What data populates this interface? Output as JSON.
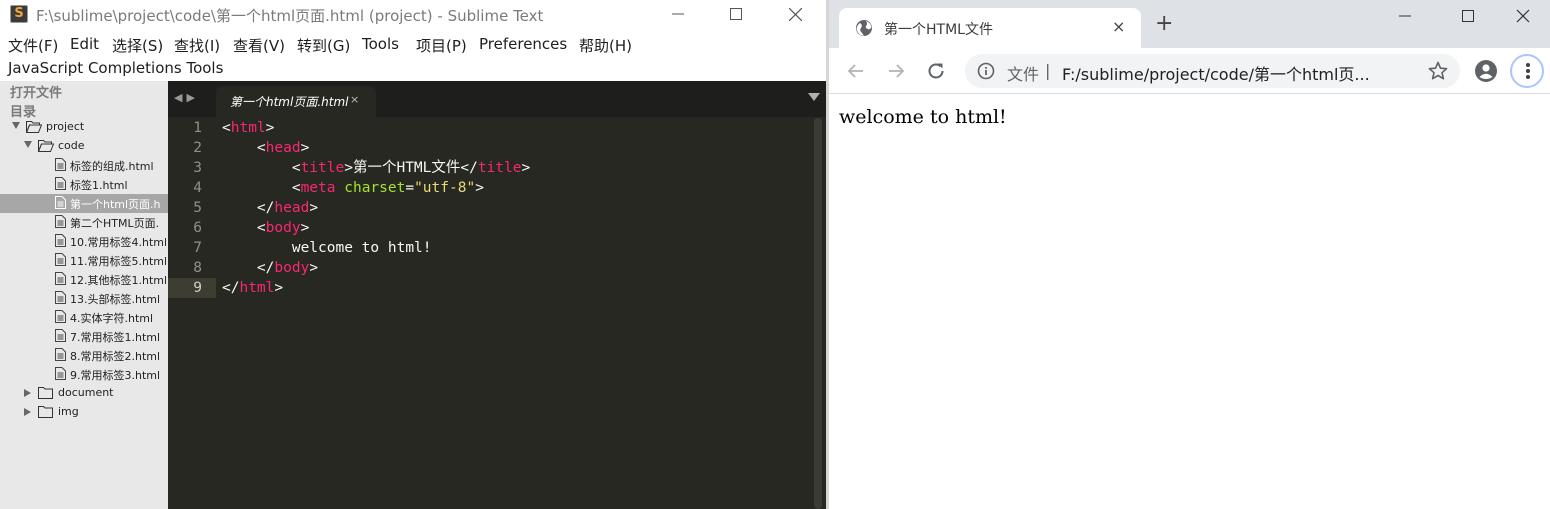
{
  "sublime": {
    "title": "F:\\sublime\\project\\code\\第一个html页面.html (project) - Sublime Text",
    "app_icon_letter": "S",
    "menu": [
      "文件(F)",
      "Edit",
      "选择(S)",
      "查找(I)",
      "查看(V)",
      "转到(G)",
      "Tools",
      "项目(P)",
      "Preferences",
      "帮助(H)"
    ],
    "menu2": "JavaScript Completions Tools",
    "sidebar": {
      "open_files": "打开文件",
      "folders": "目录",
      "tree": [
        {
          "label": "project",
          "type": "folder-open",
          "level": 0
        },
        {
          "label": "code",
          "type": "folder-open",
          "level": 1
        },
        {
          "label": "标签的组成.html",
          "type": "file",
          "level": 2
        },
        {
          "label": "标签1.html",
          "type": "file",
          "level": 2
        },
        {
          "label": "第一个html页面.h",
          "type": "file",
          "level": 2,
          "selected": true
        },
        {
          "label": "第二个HTML页面.",
          "type": "file",
          "level": 2
        },
        {
          "label": "10.常用标签4.html",
          "type": "file",
          "level": 2
        },
        {
          "label": "11.常用标签5.html",
          "type": "file",
          "level": 2
        },
        {
          "label": "12.其他标签1.html",
          "type": "file",
          "level": 2
        },
        {
          "label": "13.头部标签.html",
          "type": "file",
          "level": 2
        },
        {
          "label": "4.实体字符.html",
          "type": "file",
          "level": 2
        },
        {
          "label": "7.常用标签1.html",
          "type": "file",
          "level": 2
        },
        {
          "label": "8.常用标签2.html",
          "type": "file",
          "level": 2
        },
        {
          "label": "9.常用标签3.html",
          "type": "file",
          "level": 2
        },
        {
          "label": "document",
          "type": "folder-closed",
          "level": 1
        },
        {
          "label": "img",
          "type": "folder-closed",
          "level": 1
        }
      ]
    },
    "tab": {
      "label": "第一个html页面.html",
      "close": "×"
    },
    "code": [
      {
        "n": "1",
        "segs": [
          [
            "t",
            "<"
          ],
          [
            "g",
            "html"
          ],
          [
            "t",
            ">"
          ]
        ]
      },
      {
        "n": "2",
        "segs": [
          [
            "t",
            "    <"
          ],
          [
            "g",
            "head"
          ],
          [
            "t",
            ">"
          ]
        ]
      },
      {
        "n": "3",
        "segs": [
          [
            "t",
            "        <"
          ],
          [
            "g",
            "title"
          ],
          [
            "t",
            ">第一个HTML文件</"
          ],
          [
            "g",
            "title"
          ],
          [
            "t",
            ">"
          ]
        ]
      },
      {
        "n": "4",
        "segs": [
          [
            "t",
            "        <"
          ],
          [
            "g",
            "meta"
          ],
          [
            "t",
            " "
          ],
          [
            "a",
            "charset"
          ],
          [
            "t",
            "="
          ],
          [
            "s",
            "\"utf-8\""
          ],
          [
            "t",
            ">"
          ]
        ]
      },
      {
        "n": "5",
        "segs": [
          [
            "t",
            "    </"
          ],
          [
            "g",
            "head"
          ],
          [
            "t",
            ">"
          ]
        ]
      },
      {
        "n": "6",
        "segs": [
          [
            "t",
            "    <"
          ],
          [
            "g",
            "body"
          ],
          [
            "t",
            ">"
          ]
        ]
      },
      {
        "n": "7",
        "segs": [
          [
            "t",
            "        welcome to html!"
          ]
        ]
      },
      {
        "n": "8",
        "segs": [
          [
            "t",
            "    </"
          ],
          [
            "g",
            "body"
          ],
          [
            "t",
            ">"
          ]
        ]
      },
      {
        "n": "9",
        "segs": [
          [
            "t",
            "</"
          ],
          [
            "g",
            "html"
          ],
          [
            "t",
            ">"
          ]
        ]
      }
    ],
    "current_line": "9"
  },
  "chrome": {
    "tab_title": "第一个HTML文件",
    "tab_close": "×",
    "new_tab": "+",
    "omnibox": {
      "label": "文件",
      "separator": "|",
      "url": "F:/sublime/project/code/第一个html页..."
    },
    "page_text": "welcome to html!"
  },
  "colors": {
    "tag": "#f92672",
    "attr": "#a6e22e",
    "string": "#e6db74",
    "editor_bg": "#272822",
    "chrome_tabstrip": "#dee1e6"
  }
}
